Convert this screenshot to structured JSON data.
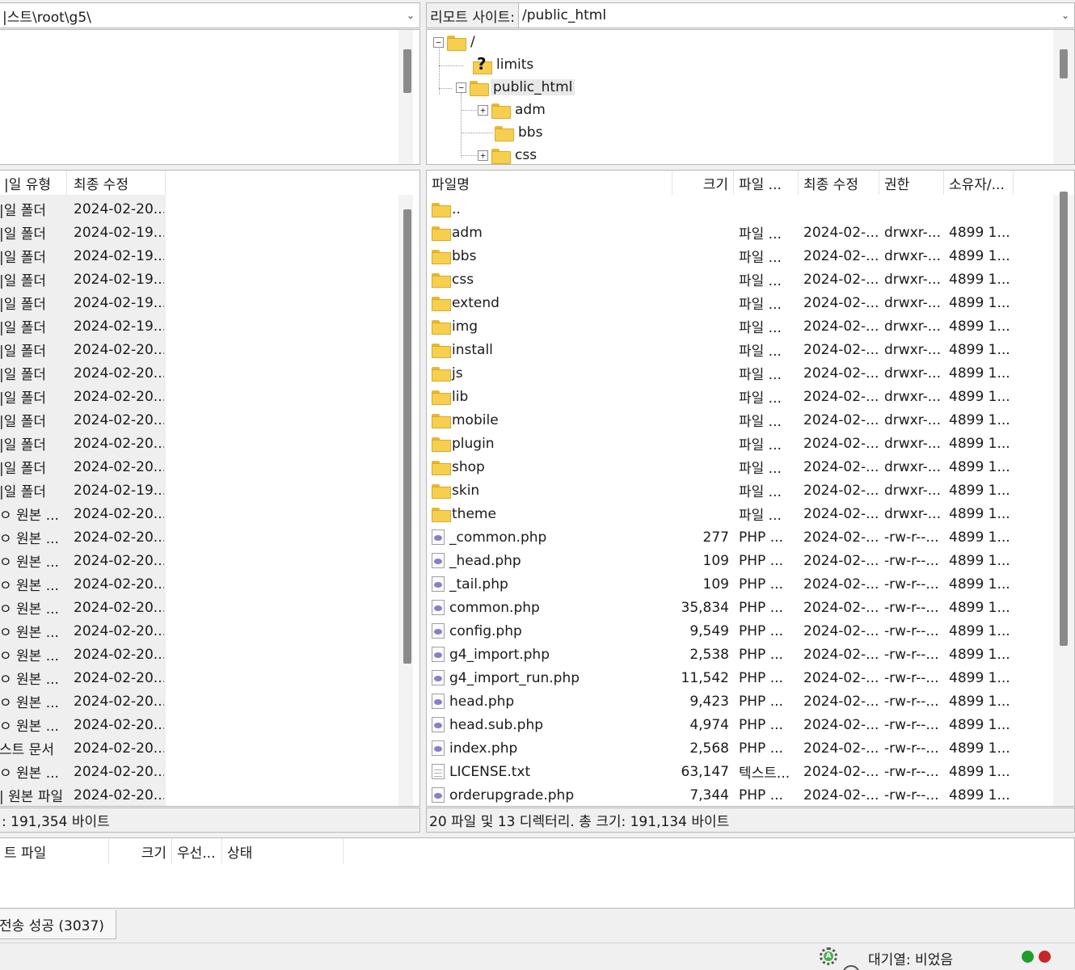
{
  "local": {
    "path": "|스트\\root\\g5\\",
    "columns": [
      "|일 유형",
      "최종 수정"
    ],
    "rows": [
      {
        "type": "|일 폴더",
        "modified": "2024-02-20..."
      },
      {
        "type": "|일 폴더",
        "modified": "2024-02-19..."
      },
      {
        "type": "|일 폴더",
        "modified": "2024-02-19..."
      },
      {
        "type": "|일 폴더",
        "modified": "2024-02-19..."
      },
      {
        "type": "|일 폴더",
        "modified": "2024-02-19..."
      },
      {
        "type": "|일 폴더",
        "modified": "2024-02-19..."
      },
      {
        "type": "|일 폴더",
        "modified": "2024-02-20..."
      },
      {
        "type": "|일 폴더",
        "modified": "2024-02-20..."
      },
      {
        "type": "|일 폴더",
        "modified": "2024-02-20..."
      },
      {
        "type": "|일 폴더",
        "modified": "2024-02-20..."
      },
      {
        "type": "|일 폴더",
        "modified": "2024-02-20..."
      },
      {
        "type": "|일 폴더",
        "modified": "2024-02-20..."
      },
      {
        "type": "|일 폴더",
        "modified": "2024-02-19..."
      },
      {
        "type": "ㅇ 원본 ...",
        "modified": "2024-02-20..."
      },
      {
        "type": "ㅇ 원본 ...",
        "modified": "2024-02-20..."
      },
      {
        "type": "ㅇ 원본 ...",
        "modified": "2024-02-20..."
      },
      {
        "type": "ㅇ 원본 ...",
        "modified": "2024-02-20..."
      },
      {
        "type": "ㅇ 원본 ...",
        "modified": "2024-02-20..."
      },
      {
        "type": "ㅇ 원본 ...",
        "modified": "2024-02-20..."
      },
      {
        "type": "ㅇ 원본 ...",
        "modified": "2024-02-20..."
      },
      {
        "type": "ㅇ 원본 ...",
        "modified": "2024-02-20..."
      },
      {
        "type": "ㅇ 원본 ...",
        "modified": "2024-02-20..."
      },
      {
        "type": "ㅇ 원본 ...",
        "modified": "2024-02-20..."
      },
      {
        "type": "스트 문서",
        "modified": "2024-02-20..."
      },
      {
        "type": "ㅇ 원본 ...",
        "modified": "2024-02-20..."
      },
      {
        "type": "| 원본 파일",
        "modified": "2024-02-20..."
      }
    ],
    "status": ": 191,354 바이트"
  },
  "remote": {
    "site_label": "리모트 사이트:",
    "path": "/public_html",
    "tree": [
      {
        "label": "/",
        "expander": "−"
      },
      {
        "label": "limits",
        "unknown": true
      },
      {
        "label": "public_html",
        "expander": "−"
      },
      {
        "label": "adm",
        "expander": "+"
      },
      {
        "label": "bbs"
      },
      {
        "label": "css",
        "expander": "+"
      }
    ],
    "columns": [
      "파일명",
      "크기",
      "파일 ...",
      "최종 수정",
      "권한",
      "소유자/..."
    ],
    "rows": [
      {
        "name": "..",
        "kind": "folder",
        "size": "",
        "type": "",
        "modified": "",
        "perm": "",
        "owner": ""
      },
      {
        "name": "adm",
        "kind": "folder",
        "size": "",
        "type": "파일 ...",
        "modified": "2024-02-...",
        "perm": "drwxr-...",
        "owner": "4899 1..."
      },
      {
        "name": "bbs",
        "kind": "folder",
        "size": "",
        "type": "파일 ...",
        "modified": "2024-02-...",
        "perm": "drwxr-...",
        "owner": "4899 1..."
      },
      {
        "name": "css",
        "kind": "folder",
        "size": "",
        "type": "파일 ...",
        "modified": "2024-02-...",
        "perm": "drwxr-...",
        "owner": "4899 1..."
      },
      {
        "name": "extend",
        "kind": "folder",
        "size": "",
        "type": "파일 ...",
        "modified": "2024-02-...",
        "perm": "drwxr-...",
        "owner": "4899 1..."
      },
      {
        "name": "img",
        "kind": "folder",
        "size": "",
        "type": "파일 ...",
        "modified": "2024-02-...",
        "perm": "drwxr-...",
        "owner": "4899 1..."
      },
      {
        "name": "install",
        "kind": "folder",
        "size": "",
        "type": "파일 ...",
        "modified": "2024-02-...",
        "perm": "drwxr-...",
        "owner": "4899 1..."
      },
      {
        "name": "js",
        "kind": "folder",
        "size": "",
        "type": "파일 ...",
        "modified": "2024-02-...",
        "perm": "drwxr-...",
        "owner": "4899 1..."
      },
      {
        "name": "lib",
        "kind": "folder",
        "size": "",
        "type": "파일 ...",
        "modified": "2024-02-...",
        "perm": "drwxr-...",
        "owner": "4899 1..."
      },
      {
        "name": "mobile",
        "kind": "folder",
        "size": "",
        "type": "파일 ...",
        "modified": "2024-02-...",
        "perm": "drwxr-...",
        "owner": "4899 1..."
      },
      {
        "name": "plugin",
        "kind": "folder",
        "size": "",
        "type": "파일 ...",
        "modified": "2024-02-...",
        "perm": "drwxr-...",
        "owner": "4899 1..."
      },
      {
        "name": "shop",
        "kind": "folder",
        "size": "",
        "type": "파일 ...",
        "modified": "2024-02-...",
        "perm": "drwxr-...",
        "owner": "4899 1..."
      },
      {
        "name": "skin",
        "kind": "folder",
        "size": "",
        "type": "파일 ...",
        "modified": "2024-02-...",
        "perm": "drwxr-...",
        "owner": "4899 1..."
      },
      {
        "name": "theme",
        "kind": "folder",
        "size": "",
        "type": "파일 ...",
        "modified": "2024-02-...",
        "perm": "drwxr-...",
        "owner": "4899 1..."
      },
      {
        "name": "_common.php",
        "kind": "php",
        "size": "277",
        "type": "PHP ...",
        "modified": "2024-02-...",
        "perm": "-rw-r--...",
        "owner": "4899 1..."
      },
      {
        "name": "_head.php",
        "kind": "php",
        "size": "109",
        "type": "PHP ...",
        "modified": "2024-02-...",
        "perm": "-rw-r--...",
        "owner": "4899 1..."
      },
      {
        "name": "_tail.php",
        "kind": "php",
        "size": "109",
        "type": "PHP ...",
        "modified": "2024-02-...",
        "perm": "-rw-r--...",
        "owner": "4899 1..."
      },
      {
        "name": "common.php",
        "kind": "php",
        "size": "35,834",
        "type": "PHP ...",
        "modified": "2024-02-...",
        "perm": "-rw-r--...",
        "owner": "4899 1..."
      },
      {
        "name": "config.php",
        "kind": "php",
        "size": "9,549",
        "type": "PHP ...",
        "modified": "2024-02-...",
        "perm": "-rw-r--...",
        "owner": "4899 1..."
      },
      {
        "name": "g4_import.php",
        "kind": "php",
        "size": "2,538",
        "type": "PHP ...",
        "modified": "2024-02-...",
        "perm": "-rw-r--...",
        "owner": "4899 1..."
      },
      {
        "name": "g4_import_run.php",
        "kind": "php",
        "size": "11,542",
        "type": "PHP ...",
        "modified": "2024-02-...",
        "perm": "-rw-r--...",
        "owner": "4899 1..."
      },
      {
        "name": "head.php",
        "kind": "php",
        "size": "9,423",
        "type": "PHP ...",
        "modified": "2024-02-...",
        "perm": "-rw-r--...",
        "owner": "4899 1..."
      },
      {
        "name": "head.sub.php",
        "kind": "php",
        "size": "4,974",
        "type": "PHP ...",
        "modified": "2024-02-...",
        "perm": "-rw-r--...",
        "owner": "4899 1..."
      },
      {
        "name": "index.php",
        "kind": "php",
        "size": "2,568",
        "type": "PHP ...",
        "modified": "2024-02-...",
        "perm": "-rw-r--...",
        "owner": "4899 1..."
      },
      {
        "name": "LICENSE.txt",
        "kind": "txt",
        "size": "63,147",
        "type": "텍스트...",
        "modified": "2024-02-...",
        "perm": "-rw-r--...",
        "owner": "4899 1..."
      },
      {
        "name": "orderupgrade.php",
        "kind": "php",
        "size": "7,344",
        "type": "PHP ...",
        "modified": "2024-02-...",
        "perm": "-rw-r--...",
        "owner": "4899 1..."
      }
    ],
    "status": "20 파일 및 13 디렉터리. 총 크기: 191,134 바이트"
  },
  "queue": {
    "columns": [
      "트 파일",
      "크기",
      "우선...",
      "상태"
    ],
    "tab_label": "전송 성공 (3037)"
  },
  "statusbar": {
    "queue_text": "대기열: 비었음",
    "led_green": "#1f9e2c",
    "led_red": "#c62828"
  }
}
